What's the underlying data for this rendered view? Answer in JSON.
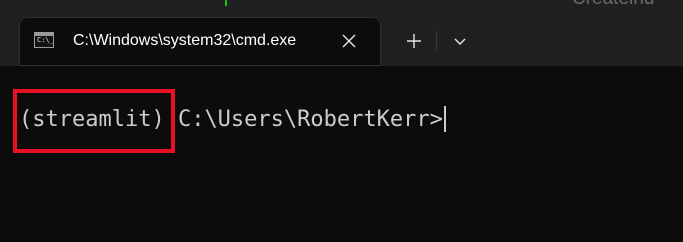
{
  "background_window": {
    "title_fragment": "Createind"
  },
  "tab": {
    "title": "C:\\Windows\\system32\\cmd.exe",
    "icon": "cmd-icon",
    "close_icon": "close-icon"
  },
  "toolbar": {
    "new_tab_icon": "plus-icon",
    "dropdown_icon": "chevron-down-icon"
  },
  "terminal": {
    "env_name": "(streamlit)",
    "path_prompt": " C:\\Users\\RobertKerr>"
  },
  "colors": {
    "terminal_bg": "#0c0c0c",
    "tabbar_bg": "#202020",
    "text": "#cccccc",
    "highlight": "#e81123"
  }
}
